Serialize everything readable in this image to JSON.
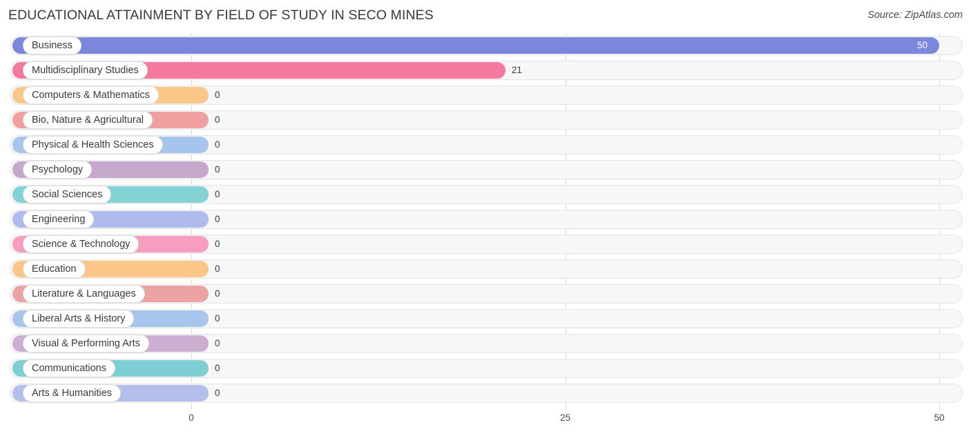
{
  "header": {
    "title": "EDUCATIONAL ATTAINMENT BY FIELD OF STUDY IN SECO MINES",
    "source": "Source: ZipAtlas.com"
  },
  "chart_data": {
    "type": "bar",
    "orientation": "horizontal",
    "title": "EDUCATIONAL ATTAINMENT BY FIELD OF STUDY IN SECO MINES",
    "xlabel": "",
    "ylabel": "",
    "xlim": [
      0,
      50
    ],
    "grid": true,
    "legend": "none",
    "xticks": [
      "0",
      "25",
      "50"
    ],
    "xtick_values": [
      0,
      25,
      50
    ],
    "categories": [
      "Business",
      "Multidisciplinary Studies",
      "Computers & Mathematics",
      "Bio, Nature & Agricultural",
      "Physical & Health Sciences",
      "Psychology",
      "Social Sciences",
      "Engineering",
      "Science & Technology",
      "Education",
      "Literature & Languages",
      "Liberal Arts & History",
      "Visual & Performing Arts",
      "Communications",
      "Arts & Humanities"
    ],
    "values": [
      50,
      21,
      0,
      0,
      0,
      0,
      0,
      0,
      0,
      0,
      0,
      0,
      0,
      0,
      0
    ],
    "value_labels": [
      "50",
      "21",
      "0",
      "0",
      "0",
      "0",
      "0",
      "0",
      "0",
      "0",
      "0",
      "0",
      "0",
      "0",
      "0"
    ],
    "colors": [
      "#7b87dd",
      "#f5789f",
      "#fbc788",
      "#f0a0a0",
      "#a6c5ec",
      "#c7a8cd",
      "#82d2d6",
      "#aebbec",
      "#f79dc0",
      "#fbc788",
      "#eca3a3",
      "#a8c6ec",
      "#cbaed2",
      "#7ecfd4",
      "#b4bfeb"
    ]
  }
}
